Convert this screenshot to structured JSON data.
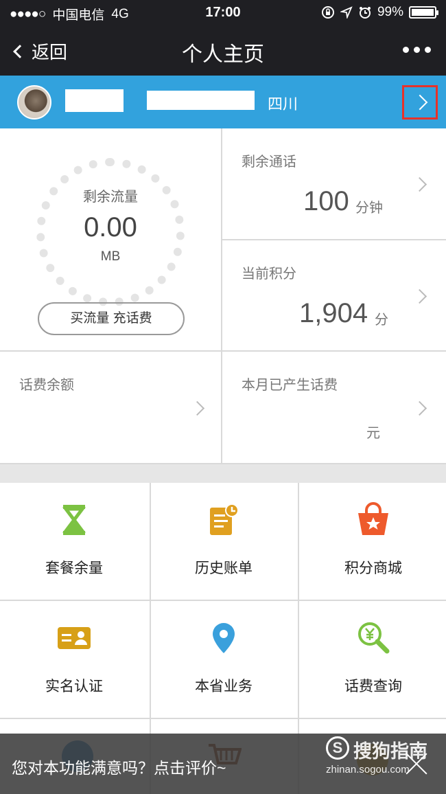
{
  "status_bar": {
    "signal": "●●●●○",
    "carrier": "中国电信",
    "network": "4G",
    "time": "17:00",
    "battery_text": "99%",
    "battery_level": 0.99
  },
  "navbar": {
    "back_label": "返回",
    "title": "个人主页"
  },
  "profile": {
    "region": "四川"
  },
  "data_usage": {
    "label": "剩余流量",
    "value": "0.00",
    "unit": "MB",
    "button": "买流量 充话费"
  },
  "call_minutes": {
    "label": "剩余通话",
    "value": "100",
    "unit": "分钟"
  },
  "points": {
    "label": "当前积分",
    "value": "1,904",
    "unit": "分"
  },
  "balance": {
    "label": "话费余额"
  },
  "monthly_fee": {
    "label": "本月已产生话费",
    "unit": "元"
  },
  "grid": [
    {
      "label": "套餐余量",
      "icon": "hourglass-icon",
      "color": "#7cc242"
    },
    {
      "label": "历史账单",
      "icon": "bill-icon",
      "color": "#e0a020"
    },
    {
      "label": "积分商城",
      "icon": "shopping-bag-icon",
      "color": "#ee5a2c"
    },
    {
      "label": "实名认证",
      "icon": "id-card-icon",
      "color": "#d7a017"
    },
    {
      "label": "本省业务",
      "icon": "location-pin-icon",
      "color": "#3aa0dc"
    },
    {
      "label": "话费查询",
      "icon": "magnifier-yen-icon",
      "color": "#7cc242"
    }
  ],
  "feedback": {
    "text": "您对本功能满意吗？点击评价~"
  },
  "watermark": {
    "logo": "S",
    "title": "搜狗指南",
    "site": "zhinan.sogou.com"
  }
}
